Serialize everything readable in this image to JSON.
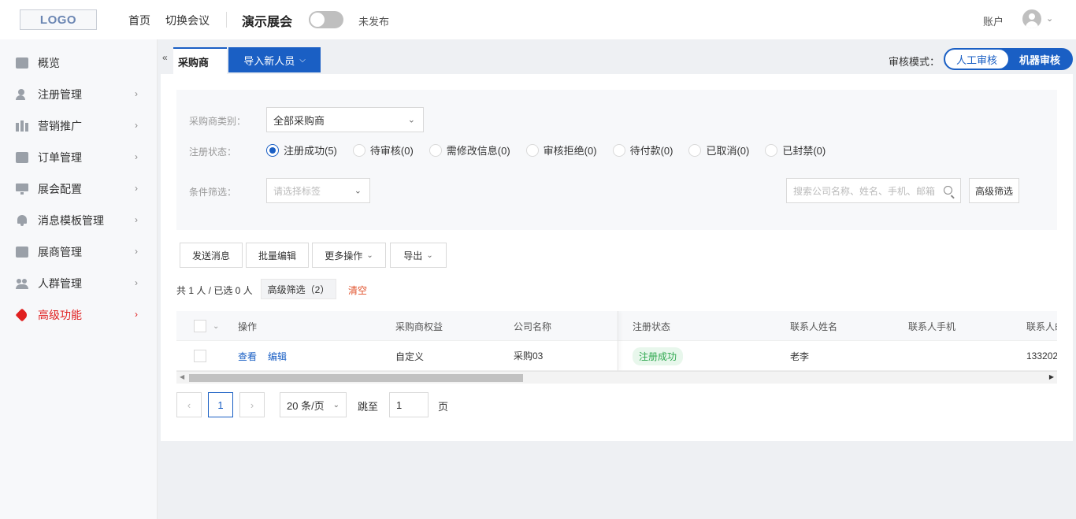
{
  "header": {
    "logo_text": "LOGO",
    "nav": [
      "首页",
      "切换会议"
    ],
    "event_title": "演示展会",
    "publish_status": "未发布",
    "account_label": "账户"
  },
  "sidebar": {
    "items": [
      {
        "label": "概览",
        "icon": "overview-icon",
        "has_arrow": false
      },
      {
        "label": "注册管理",
        "icon": "user-register-icon",
        "has_arrow": true
      },
      {
        "label": "营销推广",
        "icon": "group-icon",
        "has_arrow": true
      },
      {
        "label": "订单管理",
        "icon": "order-icon",
        "has_arrow": true
      },
      {
        "label": "展会配置",
        "icon": "monitor-icon",
        "has_arrow": true
      },
      {
        "label": "消息模板管理",
        "icon": "bell-icon",
        "has_arrow": true
      },
      {
        "label": "展商管理",
        "icon": "store-icon",
        "has_arrow": true
      },
      {
        "label": "人群管理",
        "icon": "people-icon",
        "has_arrow": true
      },
      {
        "label": "高级功能",
        "icon": "tag-icon",
        "has_arrow": true,
        "active": true
      }
    ]
  },
  "tabs": {
    "active_tab": "采购商",
    "import_button": "导入新人员",
    "review_mode_label": "审核模式：",
    "review_options": [
      "人工审核",
      "机器审核"
    ]
  },
  "filters": {
    "category_label": "采购商类别：",
    "category_value": "全部采购商",
    "status_label": "注册状态：",
    "status_options": [
      {
        "label": "注册成功(5)",
        "checked": true
      },
      {
        "label": "待审核(0)",
        "checked": false
      },
      {
        "label": "需修改信息(0)",
        "checked": false
      },
      {
        "label": "审核拒绝(0)",
        "checked": false
      },
      {
        "label": "待付款(0)",
        "checked": false
      },
      {
        "label": "已取消(0)",
        "checked": false
      },
      {
        "label": "已封禁(0)",
        "checked": false
      }
    ],
    "condition_label": "条件筛选：",
    "tag_placeholder": "请选择标签",
    "search_placeholder": "搜索公司名称、姓名、手机、邮箱",
    "advanced_button": "高级筛选"
  },
  "actions": {
    "send_message": "发送消息",
    "batch_edit": "批量编辑",
    "more_actions": "更多操作",
    "export": "导出"
  },
  "summary": {
    "count_text": "共 1 人 / 已选 0 人",
    "filter_tag": "高级筛选（2）",
    "clear": "清空"
  },
  "table": {
    "columns": [
      "操作",
      "采购商权益",
      "公司名称",
      "注册状态",
      "联系人姓名",
      "联系人手机",
      "联系人邮"
    ],
    "rows": [
      {
        "actions": [
          "查看",
          "编辑"
        ],
        "benefit": "自定义",
        "company": "采购03",
        "status": "注册成功",
        "contact_name": "老李",
        "contact_phone": "",
        "contact_email": "133202"
      }
    ]
  },
  "pagination": {
    "current_page": "1",
    "page_size": "20 条/页",
    "jump_label": "跳至",
    "jump_value": "1",
    "page_suffix": "页"
  },
  "colors": {
    "primary": "#1a5fc4",
    "active_menu": "#e02020",
    "success": "#2fa84f"
  }
}
